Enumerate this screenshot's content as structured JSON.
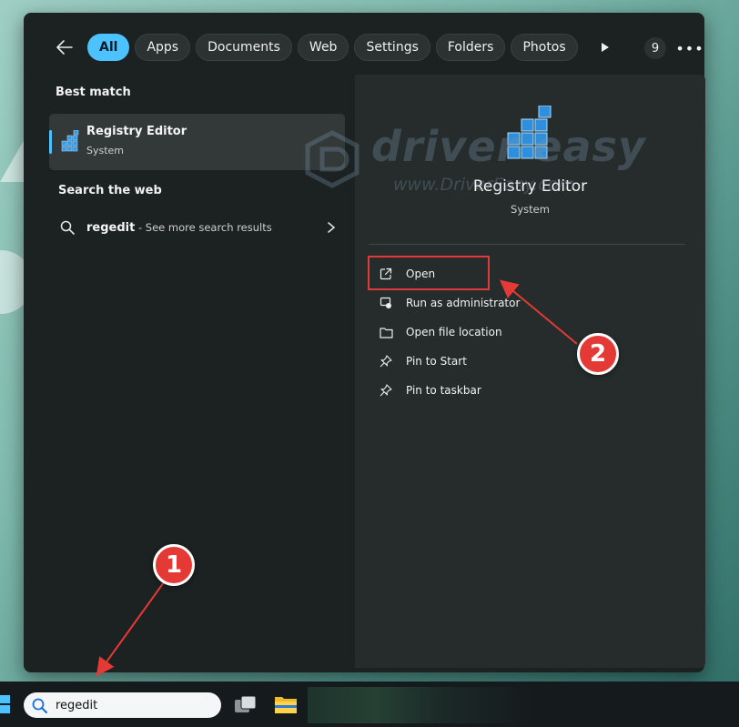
{
  "filters": {
    "chips": [
      {
        "label": "All",
        "active": true
      },
      {
        "label": "Apps"
      },
      {
        "label": "Documents"
      },
      {
        "label": "Web"
      },
      {
        "label": "Settings"
      },
      {
        "label": "Folders"
      },
      {
        "label": "Photos"
      }
    ],
    "badge_count": "9"
  },
  "best_match": {
    "heading": "Best match",
    "app_name": "Registry Editor",
    "app_type": "System"
  },
  "web": {
    "heading": "Search the web",
    "query": "regedit",
    "suffix": " - See more search results"
  },
  "detail": {
    "title": "Registry Editor",
    "subtitle": "System",
    "actions": [
      {
        "label": "Open",
        "icon": "open-external-icon"
      },
      {
        "label": "Run as administrator",
        "icon": "shield-admin-icon"
      },
      {
        "label": "Open file location",
        "icon": "folder-icon"
      },
      {
        "label": "Pin to Start",
        "icon": "pin-icon"
      },
      {
        "label": "Pin to taskbar",
        "icon": "pin-icon"
      }
    ]
  },
  "watermark": {
    "line1": "driver easy",
    "line2": "www.DriverEasy.com"
  },
  "markers": {
    "step1": "1",
    "step2": "2"
  },
  "taskbar": {
    "search_value": "regedit"
  },
  "colors": {
    "accent": "#4cc2ff",
    "annotation_red": "#e53935",
    "panel_bg": "#1c2121"
  }
}
